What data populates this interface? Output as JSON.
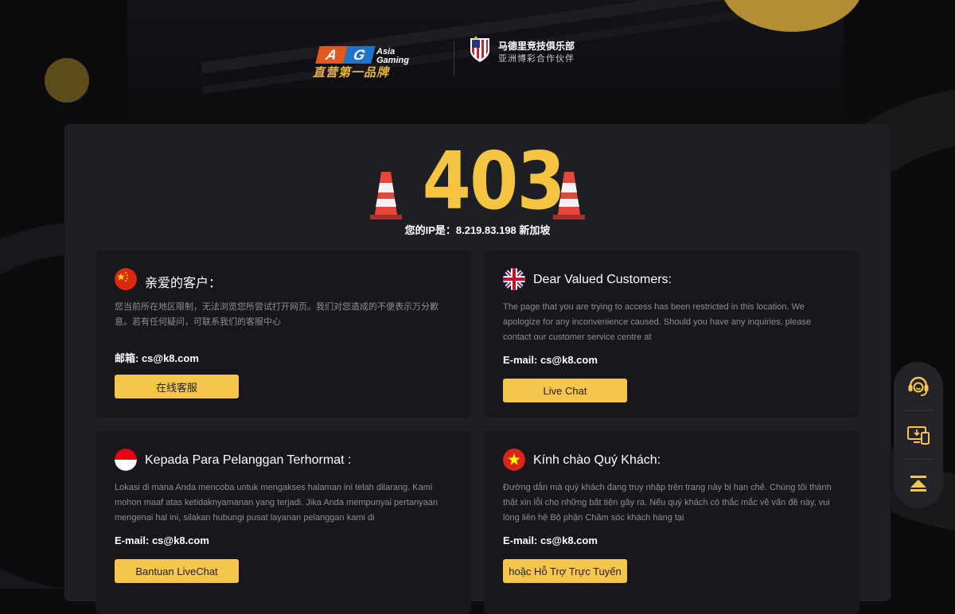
{
  "header": {
    "ag_badge_a": "A",
    "ag_badge_g": "G",
    "ag_brand_line1": "Asia",
    "ag_brand_line2": "Gaming",
    "ag_slogan": "直营第一品牌",
    "club_title": "马德里竞技俱乐部",
    "club_subtitle": "亚洲博彩合作伙伴"
  },
  "error": {
    "code": "403",
    "ip_line": "您的IP是：8.219.83.198 新加坡"
  },
  "cards": {
    "cn": {
      "title": "亲爱的客户：",
      "description": "您当前所在地区限制，无法浏览您所尝试打开网页。我们对您造成的不便表示万分歉意。若有任何疑问，可联系我们的客服中心",
      "email": "邮箱: cs@k8.com",
      "button": "在线客服"
    },
    "en": {
      "title": "Dear Valued Customers:",
      "description": "The page that you are trying to access has been restricted in this location. We apologize for any inconvenience caused. Should you have any inquiries, please contact our customer service centre at",
      "email": "E-mail: cs@k8.com",
      "button": "Live Chat"
    },
    "id": {
      "title": "Kepada Para Pelanggan Terhormat :",
      "description": "Lokasi di mana Anda mencoba untuk mengakses halaman ini telah dilarang. Kami mohon maaf atas ketidaknyamanan yang terjadi. Jika Anda mempunyai pertanyaan mengenai hal ini, silakan hubungi pusat layanan pelanggan kami di",
      "email": "E-mail: cs@k8.com",
      "button": "Bantuan LiveChat"
    },
    "vn": {
      "title": "Kính chào Quý Khách:",
      "description": "Đường dẫn mà quý khách đang truy nhập trên trang này bị hạn chế. Chúng tôi thành thật xin lỗi cho những bất tiện gây ra. Nếu quý khách có thắc mắc về vấn đề này, vui lòng liên hệ Bộ phận Chăm sóc khách hàng tại",
      "email": "E-mail: cs@k8.com",
      "button": "hoặc Hỗ Trợ Trực Tuyến"
    }
  },
  "sidebar": {
    "icons": [
      "customer-service-icon",
      "app-download-icon",
      "back-to-top-icon"
    ]
  },
  "colors": {
    "accent": "#f6c54c",
    "code": "#f5c542",
    "panel": "#1e1f24",
    "card": "#18181c",
    "cone_red": "#e8463c"
  }
}
